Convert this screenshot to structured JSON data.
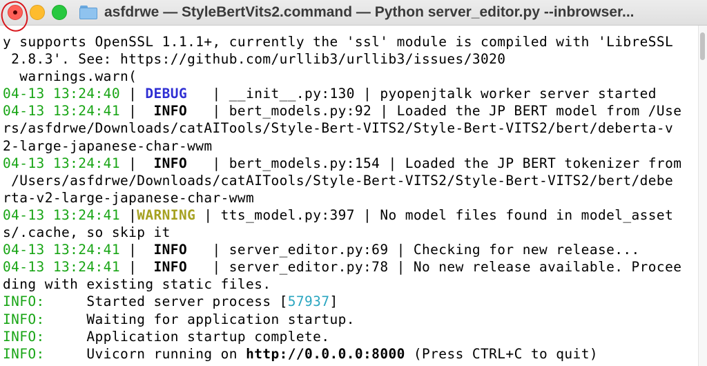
{
  "window": {
    "title": "asfdrwe — StyleBertVits2.command — Python server_editor.py --inbrowser..."
  },
  "colors": {
    "timestamp": "#18a515",
    "debug": "#2f2fd3",
    "warning": "#a6a120",
    "pid": "#2aa6c0"
  },
  "icons": [
    "close-icon",
    "minimize-icon",
    "maximize-icon",
    "folder-icon"
  ],
  "terminal": {
    "intro": [
      "y supports OpenSSL 1.1.1+, currently the 'ssl' module is compiled with 'LibreSSL",
      " 2.8.3'. See: https://github.com/urllib3/urllib3/issues/3020",
      "  warnings.warn("
    ],
    "logs": [
      {
        "ts": "04-13 13:24:40",
        "pad": " | ",
        "level": "DEBUG",
        "level_pad": "   | ",
        "kind": "debug",
        "lines": [
          "__init__.py:130 | pyopenjtalk worker server started"
        ]
      },
      {
        "ts": "04-13 13:24:41",
        "pad": " |  ",
        "level": "INFO",
        "level_pad": "   | ",
        "kind": "info",
        "lines": [
          "bert_models.py:92 | Loaded the JP BERT model from /Use",
          "rs/asfdrwe/Downloads/catAITools/Style-Bert-VITS2/Style-Bert-VITS2/bert/deberta-v",
          "2-large-japanese-char-wwm"
        ]
      },
      {
        "ts": "04-13 13:24:41",
        "pad": " |  ",
        "level": "INFO",
        "level_pad": "   | ",
        "kind": "info",
        "lines": [
          "bert_models.py:154 | Loaded the JP BERT tokenizer from",
          " /Users/asfdrwe/Downloads/catAITools/Style-Bert-VITS2/Style-Bert-VITS2/bert/debe",
          "rta-v2-large-japanese-char-wwm"
        ]
      },
      {
        "ts": "04-13 13:24:41",
        "pad": " |",
        "level": "WARNING",
        "level_pad": " | ",
        "kind": "warn",
        "lines": [
          "tts_model.py:397 | No model files found in model_asset",
          "s/.cache, so skip it"
        ]
      },
      {
        "ts": "04-13 13:24:41",
        "pad": " |  ",
        "level": "INFO",
        "level_pad": "   | ",
        "kind": "info",
        "lines": [
          "server_editor.py:69 | Checking for new release..."
        ]
      },
      {
        "ts": "04-13 13:24:41",
        "pad": " |  ",
        "level": "INFO",
        "level_pad": "   | ",
        "kind": "info",
        "lines": [
          "server_editor.py:78 | No new release available. Procee",
          "ding with existing static files."
        ]
      }
    ],
    "uvicorn": [
      {
        "prefix": "INFO:",
        "text": "     Started server process [",
        "pid": "57937",
        "after": "]"
      },
      {
        "prefix": "INFO:",
        "text": "     Waiting for application startup."
      },
      {
        "prefix": "INFO:",
        "text": "     Application startup complete."
      },
      {
        "prefix": "INFO:",
        "text": "     Uvicorn running on ",
        "url": "http://0.0.0.0:8000",
        "after": " (Press CTRL+C to quit)"
      }
    ]
  }
}
